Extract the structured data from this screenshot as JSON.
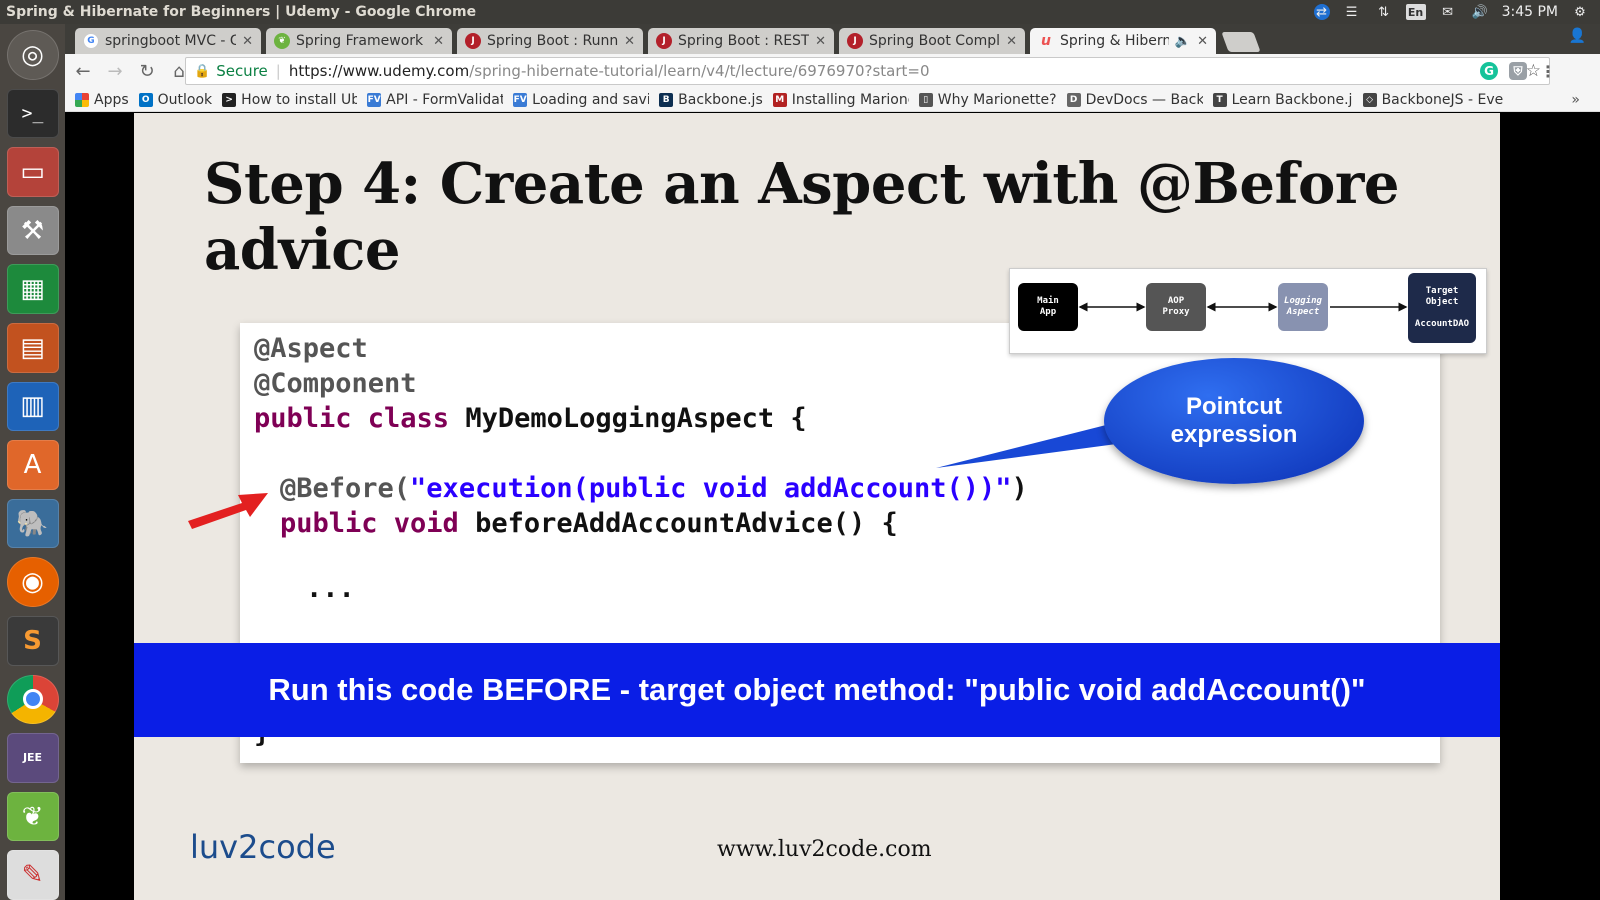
{
  "window": {
    "title": "Spring & Hibernate for Beginners | Udemy - Google Chrome",
    "keyboard_lang": "En",
    "clock": "3:45 PM"
  },
  "tabs": [
    {
      "label": "springboot MVC - Go",
      "icon": "google-icon",
      "color": "#4285f4",
      "active": false
    },
    {
      "label": "Spring Framework De",
      "icon": "spring-icon",
      "color": "#6db33f",
      "active": false
    },
    {
      "label": "Spring Boot : Running",
      "icon": "javatpoint-icon",
      "color": "#b3202a",
      "active": false
    },
    {
      "label": "Spring Boot : RESTful",
      "icon": "javatpoint-icon",
      "color": "#b3202a",
      "active": false
    },
    {
      "label": "Spring Boot Complet",
      "icon": "javatpoint-icon",
      "color": "#b3202a",
      "active": false
    },
    {
      "label": "Spring & Hibernate",
      "icon": "udemy-icon",
      "color": "#ec5252",
      "active": true
    }
  ],
  "toolbar": {
    "secure_label": "Secure",
    "url_host": "https://www.udemy.com",
    "url_path": "/spring-hibernate-tutorial/learn/v4/t/lecture/6976970?start=0"
  },
  "bookmarks": [
    {
      "label": "Apps",
      "icon": "apps-grid-icon",
      "color": "#e94235"
    },
    {
      "label": "Outlook",
      "icon": "outlook-icon",
      "color": "#0072c6"
    },
    {
      "label": "How to install Ubu",
      "icon": "terminal-icon",
      "color": "#222222"
    },
    {
      "label": "API - FormValidati",
      "icon": "fv-icon",
      "color": "#3a7bd5"
    },
    {
      "label": "Loading and savin",
      "icon": "fv-icon",
      "color": "#3a7bd5"
    },
    {
      "label": "Backbone.js",
      "icon": "backbone-icon",
      "color": "#0d2f52"
    },
    {
      "label": "Installing Marione",
      "icon": "marionette-icon",
      "color": "#b22222"
    },
    {
      "label": "Why Marionette?",
      "icon": "book-icon",
      "color": "#555555"
    },
    {
      "label": "DevDocs — Backb",
      "icon": "devdocs-icon",
      "color": "#666666"
    },
    {
      "label": "Learn Backbone.js",
      "icon": "text-icon",
      "color": "#444444"
    },
    {
      "label": "BackboneJS - Even",
      "icon": "diamond-icon",
      "color": "#444444"
    }
  ],
  "slide": {
    "title": "Step 4: Create an Aspect with @Before advice",
    "code": {
      "line1": "@Aspect",
      "line2": "@Component",
      "line3_kw": "public class ",
      "line3_rest": "MyDemoLoggingAspect {",
      "line4_ann": "@Before(",
      "line4_str": "\"execution(public void addAccount())\"",
      "line4_end": ")",
      "line5_kw": "public void ",
      "line5_rest": "beforeAddAccountAdvice() {",
      "line6": "...",
      "line7": "}"
    },
    "diagram": {
      "main_app": "Main\nApp",
      "aop_proxy": "AOP\nProxy",
      "logging_aspect": "Logging\nAspect",
      "target_object": "Target\nObject\n\nAccountDAO"
    },
    "callout_line1": "Pointcut",
    "callout_line2": "expression",
    "banner": "Run this code BEFORE - target object method:  \"public void addAccount()\"",
    "logo": "luv2code",
    "footer_url": "www.luv2code.com"
  },
  "colors": {
    "banner": "#0a1ee6",
    "keyword": "#7f0055",
    "string": "#2a00ff",
    "annotation": "#555555",
    "arrow": "#e32020"
  }
}
